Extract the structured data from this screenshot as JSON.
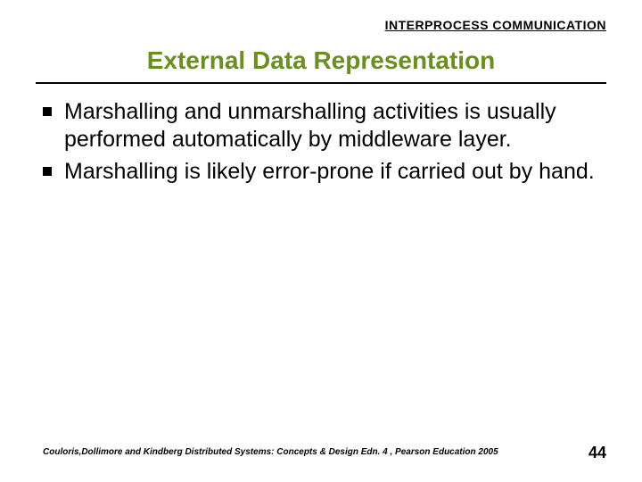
{
  "header": {
    "label": "INTERPROCESS COMMUNICATION"
  },
  "title": "External Data Representation",
  "bullets": [
    "Marshalling and unmarshalling activities is usually performed automatically by middleware layer.",
    "Marshalling is likely error-prone if carried out by hand."
  ],
  "footer": {
    "citation": "Couloris,Dollimore and Kindberg  Distributed Systems: Concepts & Design  Edn. 4 ,  Pearson Education 2005",
    "page": "44"
  }
}
